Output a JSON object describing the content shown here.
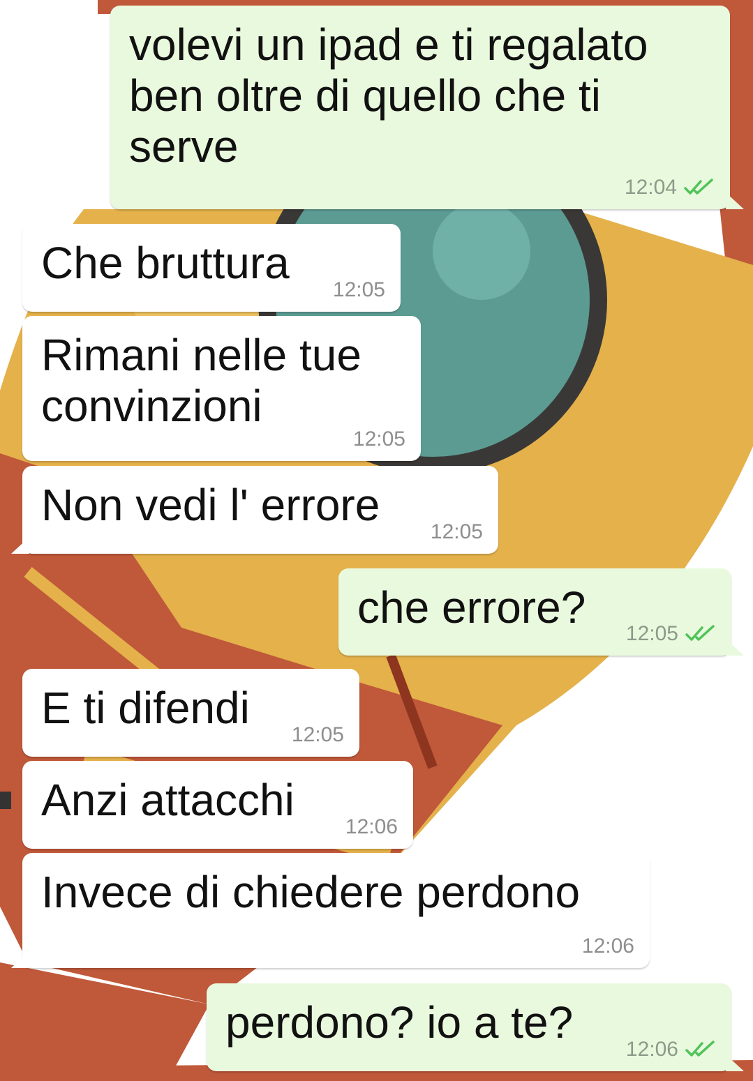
{
  "colors": {
    "incoming_bubble": "#ffffff",
    "outgoing_bubble": "#e9f9dd",
    "read_ticks": "#4fc35a",
    "timestamp": "#8e8e8e"
  },
  "messages": [
    {
      "direction": "outgoing",
      "text": "volevi un ipad e ti regalato\nben oltre di quello che ti\nserve",
      "time": "12:04",
      "status": "read",
      "status_icon": "double-check-icon"
    },
    {
      "direction": "incoming",
      "text": "Che bruttura",
      "time": "12:05"
    },
    {
      "direction": "incoming",
      "text": "Rimani nelle tue\nconvinzioni",
      "time": "12:05"
    },
    {
      "direction": "incoming",
      "text": "Non vedi l' errore",
      "time": "12:05"
    },
    {
      "direction": "outgoing",
      "text": "che errore?",
      "time": "12:05",
      "status": "read",
      "status_icon": "double-check-icon"
    },
    {
      "direction": "incoming",
      "text": "E ti difendi",
      "time": "12:05"
    },
    {
      "direction": "incoming",
      "text": "Anzi attacchi",
      "time": "12:06"
    },
    {
      "direction": "incoming",
      "text": "Invece di chiedere perdono",
      "time": "12:06"
    },
    {
      "direction": "outgoing",
      "text": "perdono? io a te?",
      "time": "12:06",
      "status": "read",
      "status_icon": "double-check-icon"
    }
  ]
}
